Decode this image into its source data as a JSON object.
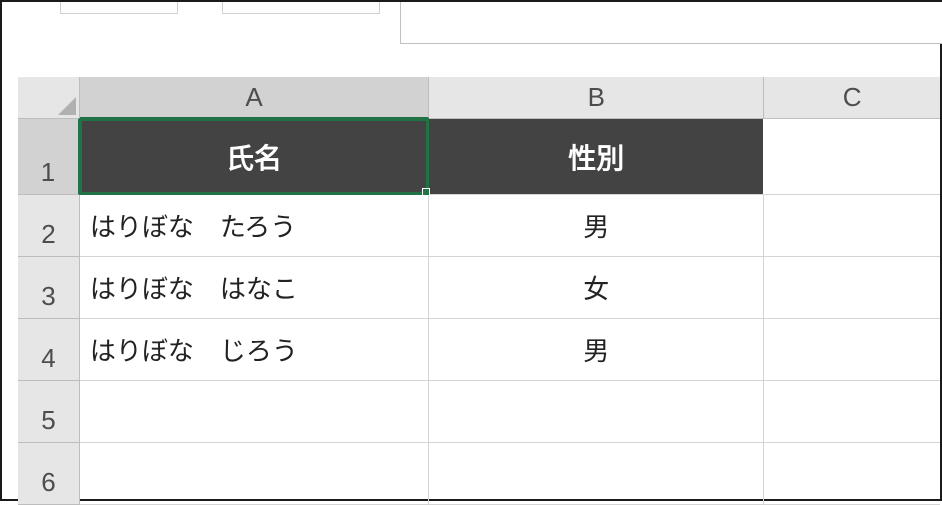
{
  "columns": {
    "a": "A",
    "b": "B",
    "c": "C"
  },
  "rows": {
    "r1": "1",
    "r2": "2",
    "r3": "3",
    "r4": "4",
    "r5": "5",
    "r6": "6"
  },
  "data": {
    "header_name": "氏名",
    "header_gender": "性別",
    "rows": [
      {
        "name": "はりぼな　たろう",
        "gender": "男"
      },
      {
        "name": "はりぼな　はなこ",
        "gender": "女"
      },
      {
        "name": "はりぼな　じろう",
        "gender": "男"
      }
    ]
  },
  "active_cell": "A1"
}
